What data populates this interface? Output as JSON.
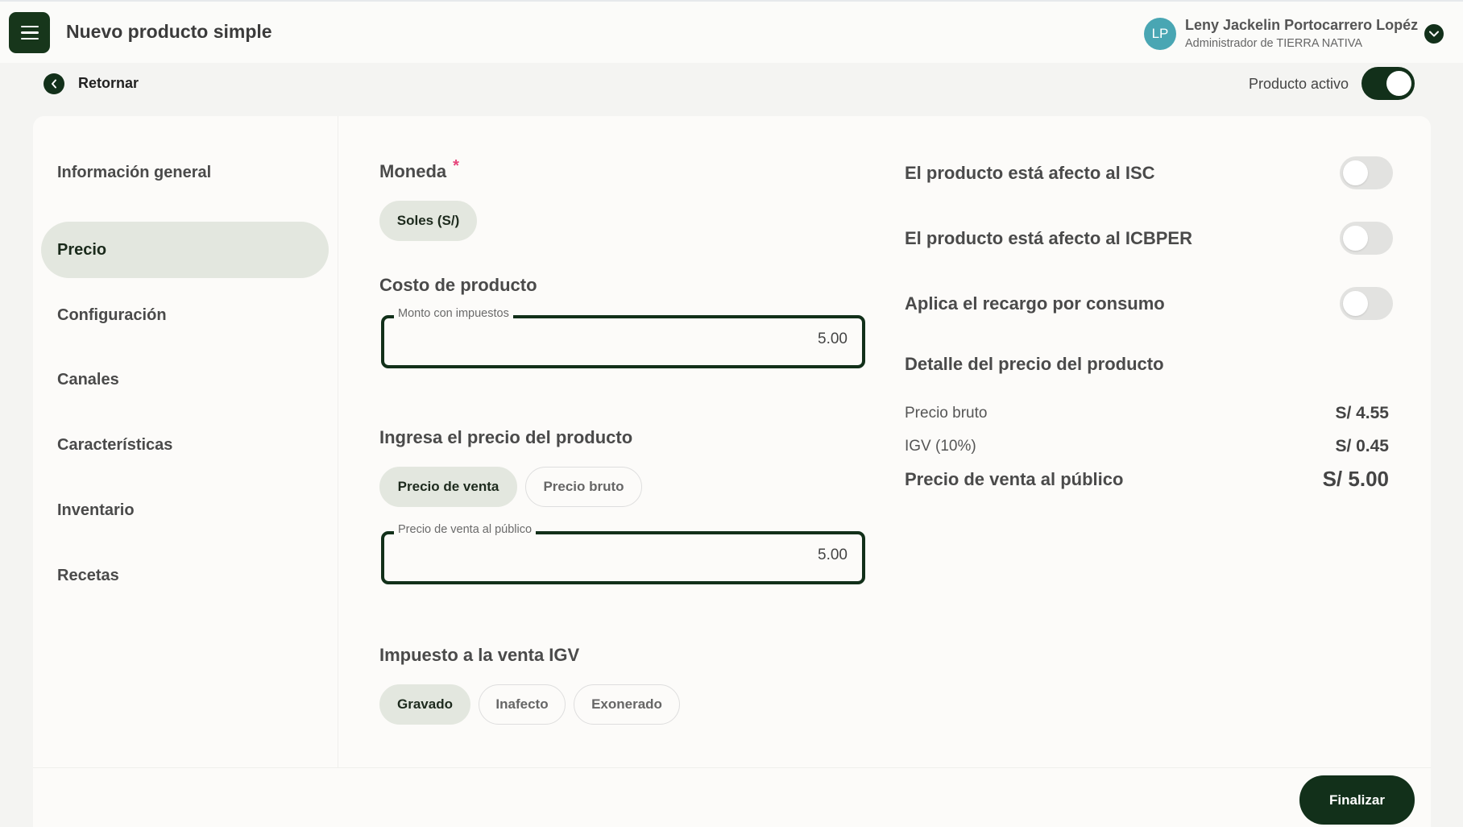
{
  "header": {
    "title": "Nuevo producto simple",
    "user": {
      "initials": "LP",
      "name": "Leny Jackelin Portocarrero Lopéz",
      "role": "Administrador de TIERRA NATIVA"
    }
  },
  "subheader": {
    "back_label": "Retornar",
    "active_label": "Producto activo",
    "active": true
  },
  "sidebar": {
    "items": [
      {
        "label": "Información general",
        "active": false
      },
      {
        "label": "Precio",
        "active": true
      },
      {
        "label": "Configuración",
        "active": false
      },
      {
        "label": "Canales",
        "active": false
      },
      {
        "label": "Características",
        "active": false
      },
      {
        "label": "Inventario",
        "active": false
      },
      {
        "label": "Recetas",
        "active": false
      }
    ]
  },
  "form": {
    "currency_title": "Moneda",
    "required_mark": "*",
    "currency_option": "Soles (S/)",
    "cost_title": "Costo de producto",
    "cost_field": {
      "label": "Monto con impuestos",
      "value": "5.00"
    },
    "price_title": "Ingresa el precio del producto",
    "price_options": [
      "Precio de venta",
      "Precio bruto"
    ],
    "price_field": {
      "label": "Precio de venta al público",
      "value": "5.00"
    },
    "igv_title": "Impuesto a la venta IGV",
    "igv_options": [
      "Gravado",
      "Inafecto",
      "Exonerado"
    ]
  },
  "taxes": {
    "isc_label": "El producto está afecto al ISC",
    "icbper_label": "El producto está afecto al ICBPER",
    "recargo_label": "Aplica el recargo por consumo"
  },
  "detail": {
    "title": "Detalle del precio del producto",
    "gross_label": "Precio bruto",
    "gross_value": "S/ 4.55",
    "igv_label": "IGV (10%)",
    "igv_value": "S/ 0.45",
    "total_label": "Precio de venta al público",
    "total_value": "S/ 5.00"
  },
  "footer": {
    "finish_label": "Finalizar"
  },
  "colors": {
    "primary": "#12301a",
    "selected_bg": "#e3e7df",
    "accent_avatar": "#49a6b3",
    "required": "#e6447a"
  }
}
